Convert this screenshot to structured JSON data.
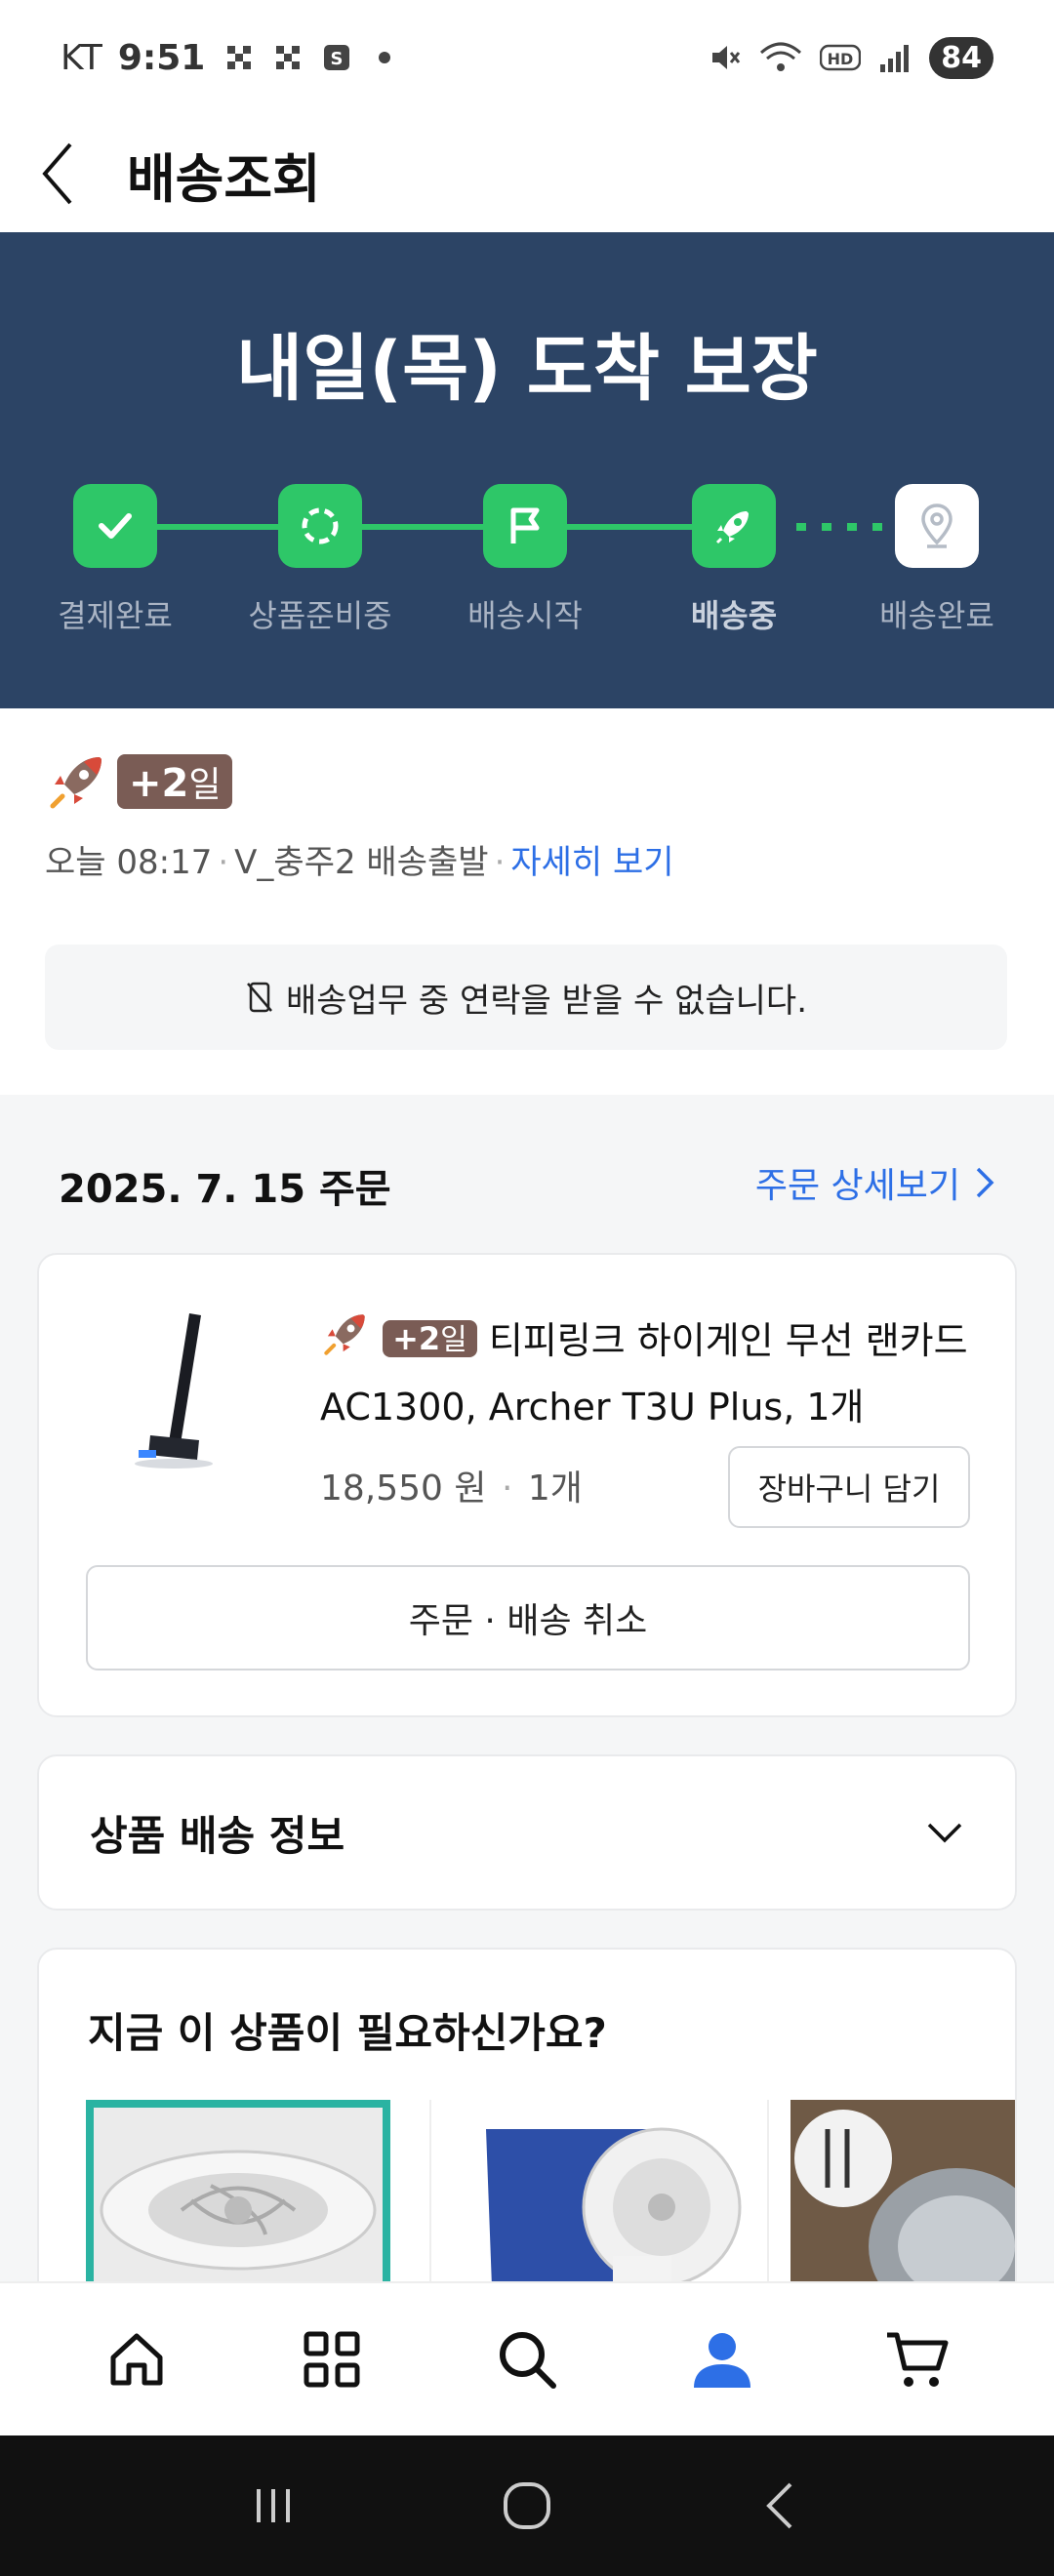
{
  "status_bar": {
    "carrier": "KT",
    "time": "9:51",
    "battery": "84"
  },
  "header": {
    "title": "배송조회"
  },
  "hero": {
    "title": "내일(목) 도착 보장",
    "steps": [
      {
        "label": "결제완료"
      },
      {
        "label": "상품준비중"
      },
      {
        "label": "배송시작"
      },
      {
        "label": "배송중"
      },
      {
        "label": "배송완료"
      }
    ]
  },
  "info": {
    "badge_plus": "+2",
    "badge_unit": "일",
    "time": "오늘 08:17",
    "location": "V_충주2 배송출발",
    "detail_link": "자세히 보기",
    "notice": "배송업무 중 연락을 받을 수 없습니다."
  },
  "order": {
    "date": "2025. 7. 15 주문",
    "detail_link": "주문 상세보기",
    "product": {
      "badge_plus": "+2",
      "badge_unit": "일",
      "name": "티피링크 하이게인 무선 랜카드 AC1300, Archer T3U Plus, 1개",
      "price": "18,550 원",
      "qty": "1개"
    },
    "cart_button": "장바구니 담기",
    "cancel_button": "주문 · 배송 취소"
  },
  "shipping_info": {
    "title": "상품 배송 정보"
  },
  "recommend": {
    "title": "지금 이 상품이 필요하신가요?"
  },
  "colors": {
    "hero_bg": "#2c4465",
    "step_green": "#2ec768",
    "link_blue": "#2d6fe6",
    "badge_brown": "#7a5c55",
    "nav_active": "#2d6fe6"
  }
}
